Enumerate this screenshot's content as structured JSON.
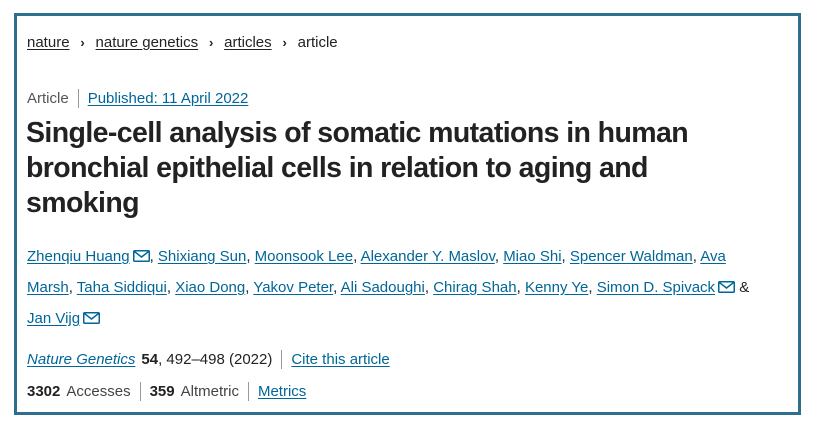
{
  "breadcrumb": {
    "items": [
      "nature",
      "nature genetics",
      "articles"
    ],
    "current": "article"
  },
  "article": {
    "type": "Article",
    "published": "Published: 11 April 2022",
    "title": "Single-cell analysis of somatic mutations in human bronchial epithelial cells in relation to aging and smoking"
  },
  "authors": [
    "Zhenqiu Huang",
    "Shixiang Sun",
    "Moonsook Lee",
    "Alexander Y. Maslov",
    "Miao Shi",
    "Spencer Waldman",
    "Ava Marsh",
    "Taha Siddiqui",
    "Xiao Dong",
    "Yakov Peter",
    "Ali Sadoughi",
    "Chirag Shah",
    "Kenny Ye",
    "Simon D. Spivack",
    "Jan Vijg"
  ],
  "author_separator": ", ",
  "author_and": " & ",
  "citation": {
    "journal": "Nature Genetics",
    "volume": "54",
    "pages_year": ", 492–498 (2022)",
    "cite_label": "Cite this article"
  },
  "metrics": {
    "accesses_count": "3302",
    "accesses_label": "Accesses",
    "altmetric_count": "359",
    "altmetric_label": "Altmetric",
    "metrics_link": "Metrics"
  },
  "icons": {
    "breadcrumb_separator": "chevron-right-icon",
    "corresponding_author": "mail-icon"
  },
  "colors": {
    "link": "#006699",
    "frame": "#2e6f8e",
    "text": "#222222"
  }
}
